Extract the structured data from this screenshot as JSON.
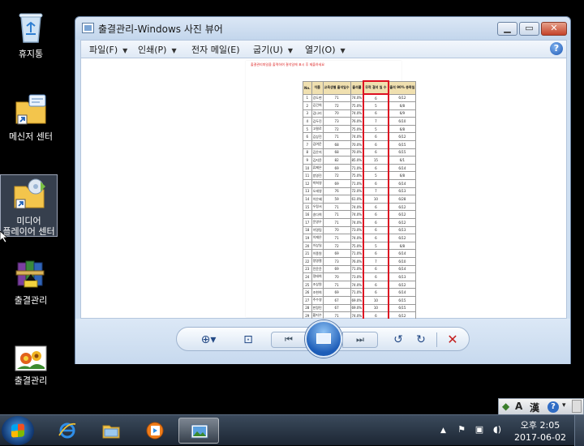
{
  "desktop": {
    "icons": [
      {
        "label": "휴지통",
        "icon": "recycle-bin-icon"
      },
      {
        "label": "메신저 센터",
        "icon": "folder-shortcut-icon"
      },
      {
        "label_line1": "미디어",
        "label_line2": "플레이어 센터",
        "icon": "folder-media-shortcut-icon"
      },
      {
        "label": "출결관리",
        "icon": "winrar-archive-icon"
      },
      {
        "label": "출결관리",
        "icon": "image-file-icon"
      }
    ]
  },
  "window": {
    "title": "출결관리-Windows 사진 뷰어",
    "menu": [
      "파일(F)",
      "인쇄(P)",
      "전자 메일(E)",
      "굽기(U)",
      "열기(O)"
    ],
    "help": "?"
  },
  "document": {
    "header": "출결관리파일을 출력하여 결석일에 표시 후 제출하세요",
    "columns": [
      "No.",
      "이름",
      "교육생별 출석일수",
      "출석률",
      "무적 결석 일 수",
      "출석 90% 충족일"
    ],
    "rows": [
      [
        "1",
        "강도현",
        "71",
        "74.0%",
        "6",
        "6/12"
      ],
      [
        "2",
        "김건희",
        "72",
        "75.0%",
        "5",
        "6/8"
      ],
      [
        "3",
        "김나리",
        "70",
        "74.0%",
        "6",
        "6/9"
      ],
      [
        "4",
        "김두진",
        "73",
        "76.0%",
        "7",
        "6/10"
      ],
      [
        "5",
        "고필로",
        "72",
        "75.0%",
        "5",
        "6/8"
      ],
      [
        "6",
        "김상진",
        "71",
        "74.0%",
        "6",
        "6/12"
      ],
      [
        "7",
        "김여운",
        "68",
        "70.0%",
        "6",
        "6/15"
      ],
      [
        "8",
        "김은지",
        "68",
        "70.0%",
        "6",
        "6/15"
      ],
      [
        "9",
        "김지윤",
        "82",
        "85.0%",
        "15",
        "6/1"
      ],
      [
        "10",
        "류제은",
        "69",
        "71.0%",
        "6",
        "6/14"
      ],
      [
        "11",
        "방영진",
        "72",
        "75.0%",
        "5",
        "6/8"
      ],
      [
        "12",
        "박희영",
        "69",
        "71.0%",
        "6",
        "6/14"
      ],
      [
        "13",
        "오세영",
        "76",
        "72.0%",
        "7",
        "6/13"
      ],
      [
        "14",
        "이은혜",
        "59",
        "61.0%",
        "10",
        "6/28"
      ],
      [
        "15",
        "우정서",
        "71",
        "74.0%",
        "6",
        "6/12"
      ],
      [
        "16",
        "송다희",
        "71",
        "74.0%",
        "6",
        "6/12"
      ],
      [
        "17",
        "윤영우",
        "71",
        "74.0%",
        "6",
        "6/12"
      ],
      [
        "18",
        "이명림",
        "70",
        "73.0%",
        "6",
        "6/13"
      ],
      [
        "19",
        "이재은",
        "71",
        "74.0%",
        "6",
        "6/12"
      ],
      [
        "20",
        "이상일",
        "72",
        "75.0%",
        "5",
        "6/8"
      ],
      [
        "21",
        "이종원",
        "69",
        "71.0%",
        "6",
        "6/14"
      ],
      [
        "22",
        "정명철",
        "73",
        "76.0%",
        "7",
        "6/10"
      ],
      [
        "23",
        "전윤윤",
        "69",
        "71.0%",
        "6",
        "6/14"
      ],
      [
        "24",
        "정태희",
        "70",
        "73.0%",
        "6",
        "6/13"
      ],
      [
        "25",
        "조상원",
        "71",
        "74.0%",
        "6",
        "6/12"
      ],
      [
        "26",
        "조현희",
        "69",
        "71.0%",
        "6",
        "6/14"
      ],
      [
        "27",
        "주수영",
        "67",
        "69.0%",
        "10",
        "6/15"
      ],
      [
        "28",
        "한정민",
        "67",
        "69.0%",
        "10",
        "6/15"
      ],
      [
        "29",
        "황지수",
        "71",
        "74.0%",
        "6",
        "6/12"
      ]
    ]
  },
  "controls": {
    "zoom": "⊕▾",
    "actual_size": "⊡",
    "prev": "⏮",
    "next": "⏭",
    "rotate_left": "↺",
    "rotate_right": "↻",
    "delete": "✕"
  },
  "taskbar": {
    "apps": [
      "internet-explorer-icon",
      "file-explorer-icon",
      "media-player-icon",
      "photo-viewer-icon"
    ],
    "time": "오후 2:05",
    "date": "2017-06-02"
  },
  "language_bar": {
    "mode": "A",
    "hanja": "漢"
  },
  "colors": {
    "window_frame": "#cfdff1",
    "accent_blue": "#1d5db8",
    "highlight_red": "#d12222",
    "taskbar": "#1c2633"
  }
}
